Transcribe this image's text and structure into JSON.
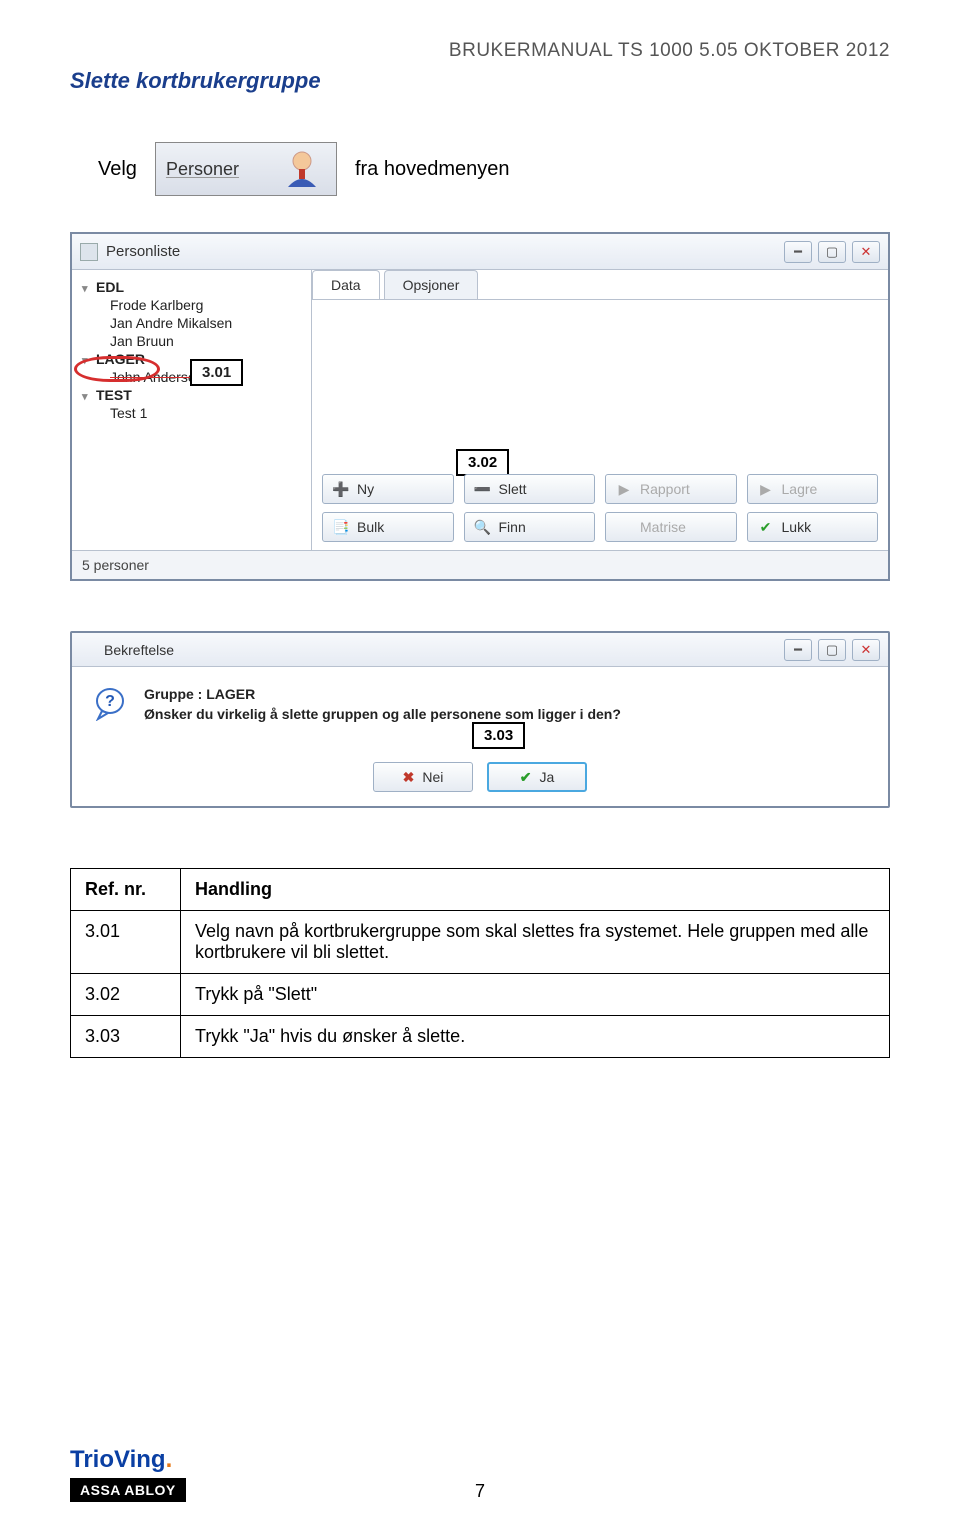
{
  "doc_header": "BRUKERMANUAL TS 1000 5.05 OKTOBER 2012",
  "section_title": "Slette kortbrukergruppe",
  "velg_line": {
    "before": "Velg",
    "button_label": "Personer",
    "after": "fra hovedmenyen"
  },
  "callouts": {
    "c301": "3.01",
    "c302": "3.02",
    "c303": "3.03"
  },
  "personliste": {
    "title": "Personliste",
    "tree": {
      "root1": "EDL",
      "root1_children": [
        "Frode Karlberg",
        "Jan Andre Mikalsen",
        "Jan Bruun"
      ],
      "root2": "LAGER",
      "root2_children": [
        "John Andersen"
      ],
      "root3": "TEST",
      "root3_children": [
        "Test 1"
      ]
    },
    "tabs": {
      "data": "Data",
      "opsjoner": "Opsjoner"
    },
    "toolbar": {
      "ny": "Ny",
      "slett": "Slett",
      "rapport": "Rapport",
      "lagre": "Lagre",
      "bulk": "Bulk",
      "finn": "Finn",
      "matrise": "Matrise",
      "lukk": "Lukk"
    },
    "status": "5 personer"
  },
  "dialog": {
    "title": "Bekreftelse",
    "line1": "Gruppe : LAGER",
    "line2": "Ønsker du virkelig å slette gruppen og alle personene som ligger i den?",
    "nei": "Nei",
    "ja": "Ja"
  },
  "steps": {
    "header_ref": "Ref. nr.",
    "header_action": "Handling",
    "rows": [
      {
        "ref": "3.01",
        "action": "Velg navn på kortbrukergruppe som skal slettes fra systemet. Hele gruppen med alle kortbrukere vil bli slettet."
      },
      {
        "ref": "3.02",
        "action": "Trykk på \"Slett\""
      },
      {
        "ref": "3.03",
        "action": "Trykk \"Ja\" hvis du ønsker å slette."
      }
    ]
  },
  "footer": {
    "page_number": "7",
    "logo1": "TrioVing",
    "logo2": "ASSA ABLOY"
  }
}
